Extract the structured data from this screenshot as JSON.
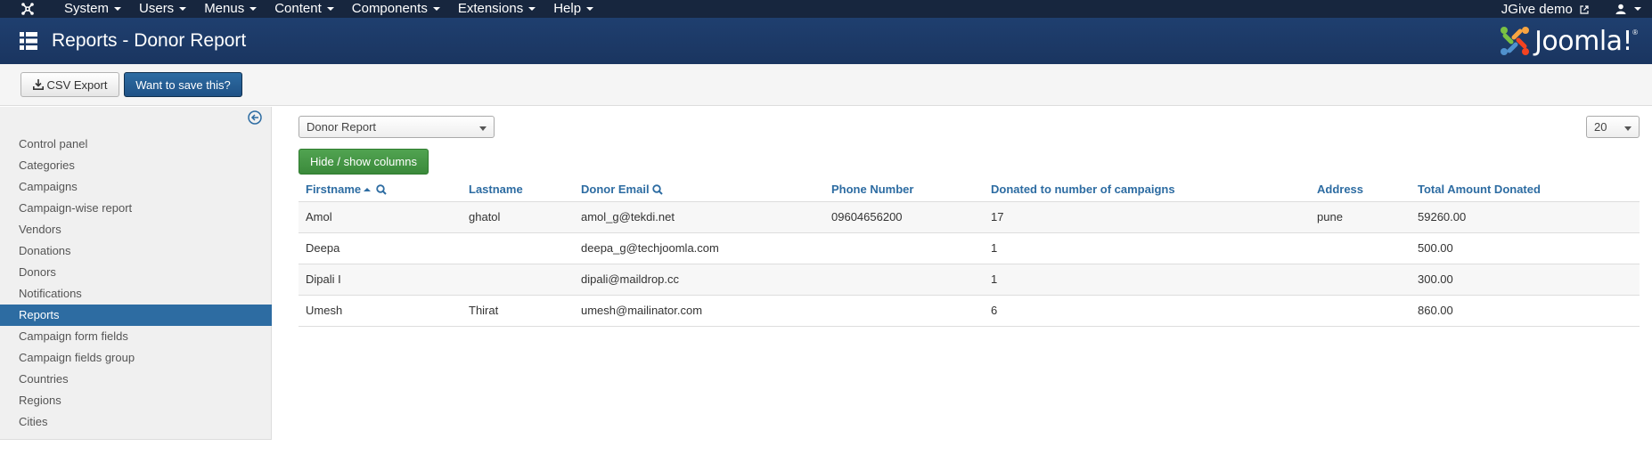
{
  "navbar": {
    "menu": [
      {
        "label": "System"
      },
      {
        "label": "Users"
      },
      {
        "label": "Menus"
      },
      {
        "label": "Content"
      },
      {
        "label": "Components"
      },
      {
        "label": "Extensions"
      },
      {
        "label": "Help"
      }
    ],
    "site_name": "JGive demo"
  },
  "header": {
    "title": "Reports - Donor Report",
    "logo_text": "Joomla!"
  },
  "toolbar": {
    "csv_label": "CSV Export",
    "save_label": "Want to save this?"
  },
  "sidebar": {
    "items": [
      {
        "label": "Control panel"
      },
      {
        "label": "Categories"
      },
      {
        "label": "Campaigns"
      },
      {
        "label": "Campaign-wise report"
      },
      {
        "label": "Vendors"
      },
      {
        "label": "Donations"
      },
      {
        "label": "Donors"
      },
      {
        "label": "Notifications"
      },
      {
        "label": "Reports"
      },
      {
        "label": "Campaign form fields"
      },
      {
        "label": "Campaign fields group"
      },
      {
        "label": "Countries"
      },
      {
        "label": "Regions"
      },
      {
        "label": "Cities"
      }
    ],
    "active": "Reports"
  },
  "filters": {
    "report_select": "Donor Report",
    "limit": "20",
    "columns_button": "Hide / show columns"
  },
  "table": {
    "headers": [
      "Firstname",
      "Lastname",
      "Donor Email",
      "Phone Number",
      "Donated to number of campaigns",
      "Address",
      "Total Amount Donated"
    ],
    "rows": [
      [
        "Amol",
        "ghatol",
        "amol_g@tekdi.net",
        "09604656200",
        "17",
        "pune",
        "59260.00"
      ],
      [
        "Deepa",
        "",
        "deepa_g@techjoomla.com",
        "",
        "1",
        "",
        "500.00"
      ],
      [
        "Dipali I",
        "",
        "dipali@maildrop.cc",
        "",
        "1",
        "",
        "300.00"
      ],
      [
        "Umesh",
        "Thirat",
        "umesh@mailinator.com",
        "",
        "6",
        "",
        "860.00"
      ]
    ]
  },
  "colors": {
    "navbar": "#17263e",
    "header": "#1f3d6d",
    "accent": "#2d6ca2",
    "success": "#51a351"
  }
}
